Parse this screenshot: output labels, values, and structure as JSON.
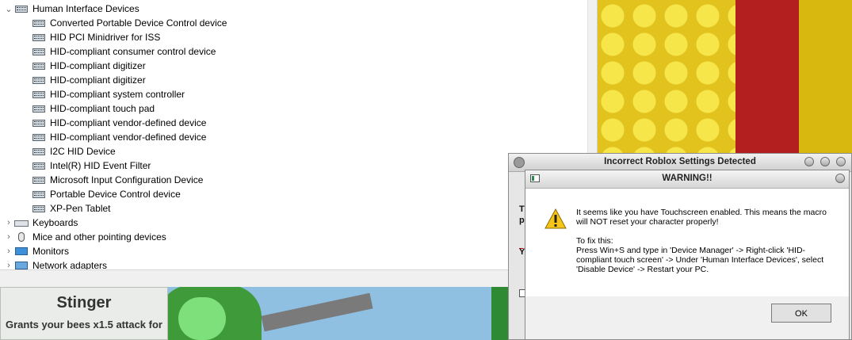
{
  "device_manager": {
    "category_expanded": {
      "label": "Human Interface Devices",
      "devices": [
        "Converted Portable Device Control device",
        "HID PCI Minidriver for ISS",
        "HID-compliant consumer control device",
        "HID-compliant digitizer",
        "HID-compliant digitizer",
        "HID-compliant system controller",
        "HID-compliant touch pad",
        "HID-compliant vendor-defined device",
        "HID-compliant vendor-defined device",
        "I2C HID Device",
        "Intel(R) HID Event Filter",
        "Microsoft Input Configuration Device",
        "Portable Device Control device",
        "XP-Pen Tablet"
      ]
    },
    "categories_collapsed": [
      {
        "label": "Keyboards",
        "icon": "keyboard-icon"
      },
      {
        "label": "Mice and other pointing devices",
        "icon": "mouse-icon"
      },
      {
        "label": "Monitors",
        "icon": "monitor-icon"
      },
      {
        "label": "Network adapters",
        "icon": "network-adapter-icon"
      }
    ]
  },
  "game": {
    "stinger_card": {
      "title": "Stinger",
      "description": "Grants your bees x1.5 attack for"
    }
  },
  "roblox_settings_window": {
    "title": "Incorrect Roblox Settings Detected",
    "fragments": [
      "Th",
      "pl",
      "Yo"
    ]
  },
  "warning_dialog": {
    "title": "WARNING!!",
    "message_line1": "It seems like you have Touchscreen enabled. This means the macro will NOT reset your character properly!",
    "message_line2": "To fix this:",
    "message_line3": "Press Win+S and type in 'Device Manager' -> Right-click 'HID-compliant touch screen' -> Under 'Human Interface Devices', select 'Disable Device' -> Restart your PC.",
    "ok_label": "OK",
    "icon": "warning-triangle-icon"
  },
  "colors": {
    "warning_yellow": "#f5c518",
    "selection": "#cce8ff"
  }
}
